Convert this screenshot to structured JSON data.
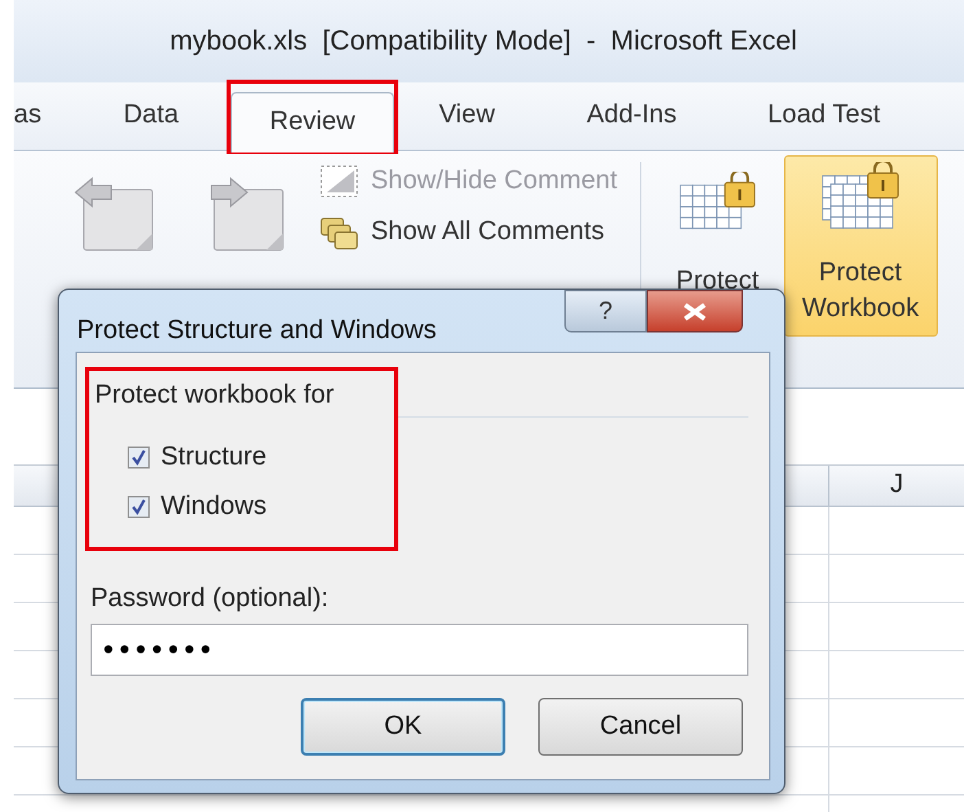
{
  "window": {
    "title": "mybook.xls  [Compatibility Mode]  -  Microsoft Excel"
  },
  "tabs": [
    {
      "label": "as",
      "selected": false,
      "highlighted": false
    },
    {
      "label": "Data",
      "selected": false,
      "highlighted": false
    },
    {
      "label": "Review",
      "selected": true,
      "highlighted": true
    },
    {
      "label": "View",
      "selected": false,
      "highlighted": false
    },
    {
      "label": "Add-Ins",
      "selected": false,
      "highlighted": false
    },
    {
      "label": "Load Test",
      "selected": false,
      "highlighted": false
    }
  ],
  "ribbon": {
    "navigation": [
      {
        "kind": "previous"
      },
      {
        "kind": "next"
      }
    ],
    "comment_commands": [
      {
        "label": "Show/Hide Comment",
        "disabled": true
      },
      {
        "label": "Show All Comments",
        "disabled": false
      }
    ],
    "protect": [
      {
        "label": "Protect",
        "kind": "sheet",
        "selected": false
      },
      {
        "label": "Protect Workbook",
        "kind": "workbook",
        "selected": true
      }
    ]
  },
  "sheet": {
    "columns": [
      {
        "label": "J"
      }
    ]
  },
  "dialog": {
    "title": "Protect Structure and Windows",
    "help": "?",
    "group": {
      "label": "Protect workbook for",
      "highlighted": true,
      "options": [
        {
          "label": "Structure",
          "checked": true
        },
        {
          "label": "Windows",
          "checked": true
        }
      ]
    },
    "password": {
      "label": "Password (optional):",
      "value": "•••••••"
    },
    "buttons": [
      {
        "label": "OK",
        "default": true
      },
      {
        "label": "Cancel",
        "default": false
      }
    ]
  }
}
